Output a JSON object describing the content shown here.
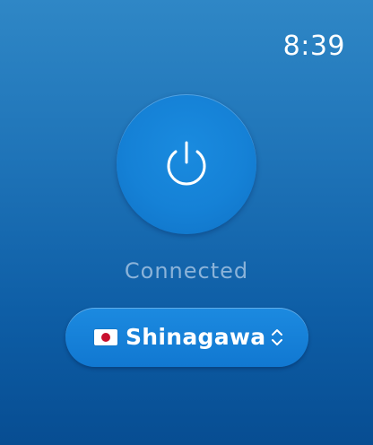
{
  "clock": {
    "time": "8:39"
  },
  "power": {
    "icon": "power-icon",
    "state": "on"
  },
  "status": {
    "text": "Connected"
  },
  "location": {
    "flag_icon": "japan-flag-icon",
    "label": "Shinagawa",
    "selector_icon": "chevron-up-down-icon"
  },
  "colors": {
    "background_top": "#2f87c6",
    "background_bottom": "#074d92",
    "button": "#1581d6",
    "status_text": "#8bb3d9",
    "flag_red": "#c8102e"
  }
}
